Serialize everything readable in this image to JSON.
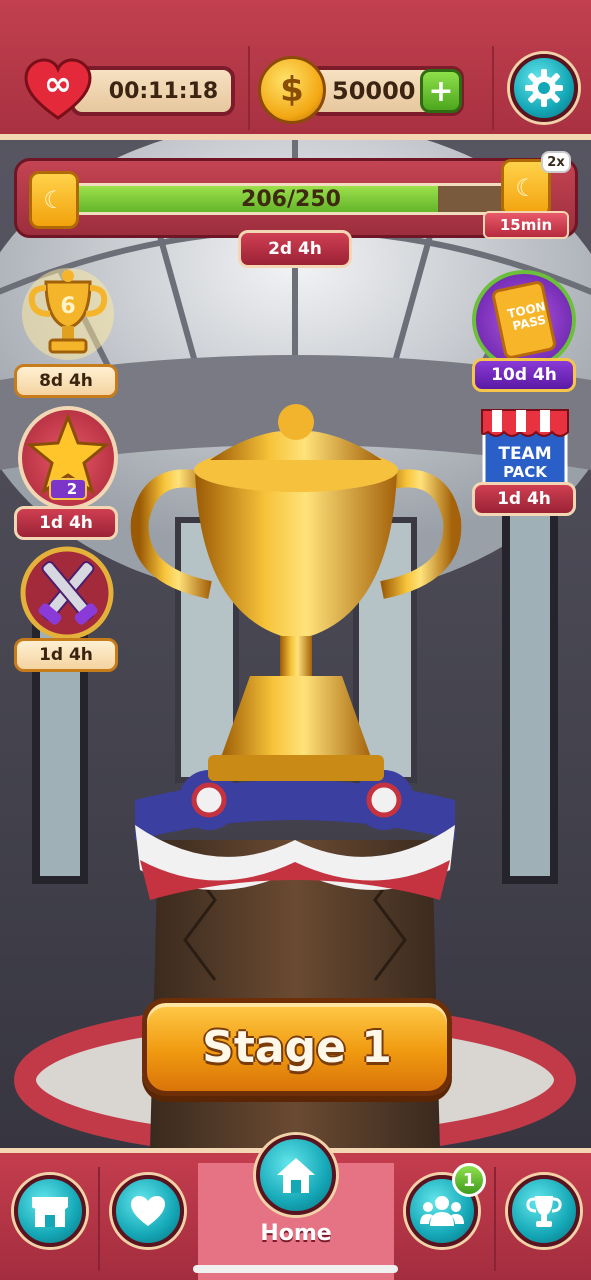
{
  "top_bar": {
    "lives_timer": "00:11:18",
    "lives_symbol": "∞",
    "coins": "50000",
    "coin_symbol": "$",
    "plus_label": "+"
  },
  "progress": {
    "value": 206,
    "max": 250,
    "text": "206/250",
    "multiplier": "2x",
    "boost_timer": "15min",
    "season_timer": "2d 4h"
  },
  "left_events": [
    {
      "name": "trophy-event",
      "badge": "6",
      "timer": "8d 4h"
    },
    {
      "name": "star-event",
      "badge": "2",
      "timer": "1d 4h"
    },
    {
      "name": "battle-event",
      "timer": "1d 4h"
    }
  ],
  "right_events": [
    {
      "name": "toon-pass",
      "title": "TOON PASS",
      "timer": "10d 4h"
    },
    {
      "name": "team-pack",
      "title_line1": "TEAM",
      "title_line2": "PACK",
      "timer": "1d 4h"
    }
  ],
  "stage_button": {
    "label": "Stage 1"
  },
  "bottom_nav": {
    "home_label": "Home",
    "friends_badge": "1"
  },
  "colors": {
    "frame_red": "#b53646",
    "teal": "#14a7b6",
    "gold": "#f3a814",
    "green": "#63b52a"
  }
}
